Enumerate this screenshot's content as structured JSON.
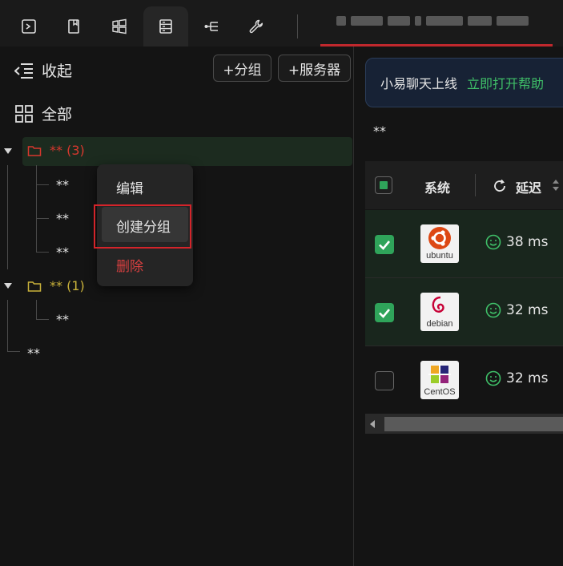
{
  "toolbar": {
    "icons": [
      "terminal-icon",
      "bookmark-icon",
      "windows-icon",
      "server-list-icon",
      "tree-icon",
      "wrench-icon"
    ],
    "active_index": 3,
    "tab_title": ""
  },
  "sidebar": {
    "collapse_label": "收起",
    "all_label": "全部",
    "add_group_label": "+分组",
    "add_server_label": "+服务器",
    "groups": [
      {
        "label": "** (3)",
        "color": "#d8382e",
        "children": [
          "**",
          "**",
          "**"
        ]
      },
      {
        "label": "** (1)",
        "color": "#c9b23a",
        "children": [
          "**"
        ]
      }
    ],
    "root_leaf": "**"
  },
  "context_menu": {
    "items": [
      {
        "label": "编辑",
        "color": "#e6e6e6"
      },
      {
        "label": "创建分组",
        "color": "#e6e6e6",
        "highlighted": true
      },
      {
        "label": "删除",
        "color": "#d94040"
      }
    ]
  },
  "main": {
    "banner_text": "小易聊天上线",
    "banner_link": "立即打开帮助",
    "breadcrumb": "**",
    "table": {
      "headers": {
        "system": "系统",
        "latency": "延迟"
      },
      "rows": [
        {
          "checked": true,
          "os": "ubuntu",
          "latency": "38 ms"
        },
        {
          "checked": true,
          "os": "debian",
          "latency": "32 ms"
        },
        {
          "checked": false,
          "os": "CentOS",
          "latency": "32 ms"
        }
      ]
    }
  },
  "colors": {
    "accent_green": "#2fa45a",
    "danger_red": "#d4242a",
    "link_green": "#3fbf68"
  }
}
